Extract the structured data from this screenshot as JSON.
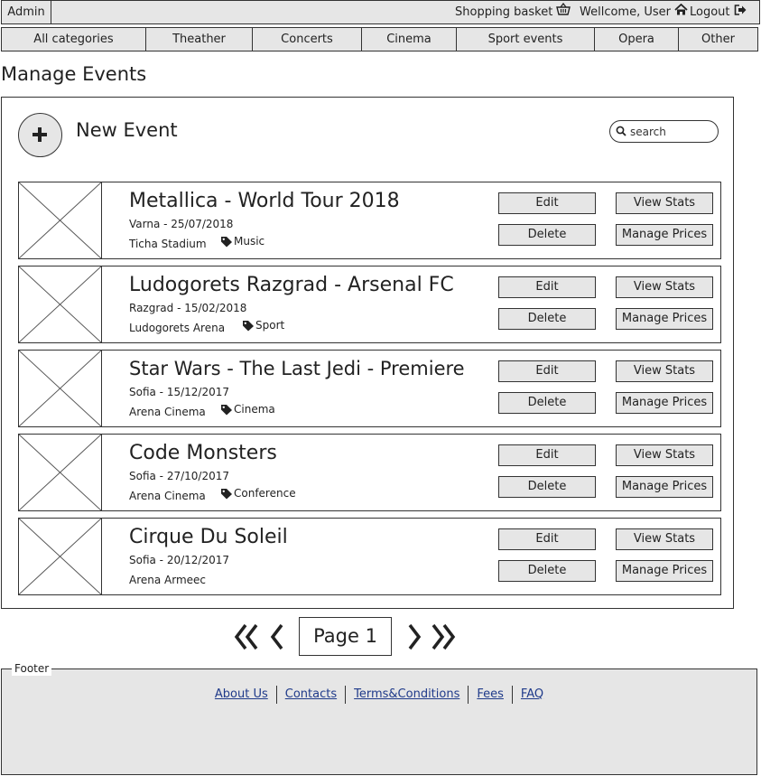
{
  "topbar": {
    "admin_label": "Admin",
    "basket_label": "Shopping basket",
    "welcome_label": "Wellcome, User",
    "logout_label": "Logout"
  },
  "categories": [
    "All categories",
    "Theather",
    "Concerts",
    "Cinema",
    "Sport events",
    "Opera",
    "Other"
  ],
  "page_title": "Manage Events",
  "toolbar": {
    "new_event_label": "New Event",
    "search_placeholder": "search"
  },
  "buttons": {
    "edit": "Edit",
    "delete": "Delete",
    "view_stats": "View Stats",
    "manage_prices": "Manage Prices"
  },
  "events": [
    {
      "title": "Metallica - World Tour 2018",
      "date": "Varna - 25/07/2018",
      "venue": "Ticha Stadium",
      "tag": "Music"
    },
    {
      "title": "Ludogorets Razgrad - Arsenal FC",
      "date": "Razgrad - 15/02/2018",
      "venue": "Ludogorets Arena",
      "tag": "Sport"
    },
    {
      "title": "Star Wars - The Last Jedi - Premiere",
      "date": "Sofia - 15/12/2017",
      "venue": "Arena Cinema",
      "tag": "Cinema"
    },
    {
      "title": "Code Monsters",
      "date": "Sofia - 27/10/2017",
      "venue": "Arena Cinema",
      "tag": "Conference"
    },
    {
      "title": "Cirque Du Soleil",
      "date": "Sofia - 20/12/2017",
      "venue": "Arena Armeec",
      "tag": ""
    }
  ],
  "pagination": {
    "current_label": "Page 1"
  },
  "footer": {
    "legend": "Footer",
    "links": [
      "About Us",
      "Contacts",
      "Terms&Conditions",
      "Fees",
      "FAQ"
    ]
  }
}
